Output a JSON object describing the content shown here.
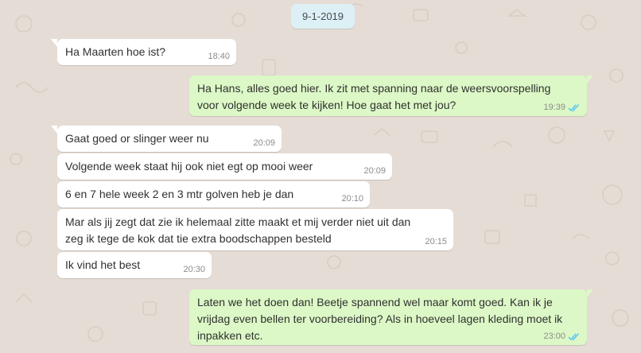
{
  "conversation": {
    "date": "9-1-2019",
    "messages": [
      {
        "direction": "in",
        "text": [
          "Ha Maarten hoe ist?"
        ],
        "time": "18:40"
      },
      {
        "direction": "out",
        "text": [
          "Ha Hans, alles goed hier. Ik zit met spanning naar de weersvoorspelling",
          "voor volgende week te kijken! Hoe gaat het met jou?"
        ],
        "time": "19:39",
        "status": "read"
      },
      {
        "direction": "in",
        "text": [
          "Gaat goed or slinger weer nu"
        ],
        "time": "20:09"
      },
      {
        "direction": "in",
        "text": [
          "Volgende week staat hij ook niet egt op mooi weer"
        ],
        "time": "20:09"
      },
      {
        "direction": "in",
        "text": [
          "6 en 7 hele week 2 en 3 mtr golven heb je dan"
        ],
        "time": "20:10"
      },
      {
        "direction": "in",
        "text": [
          "Mar als jij zegt dat zie ik helemaal zitte maakt et mij verder niet uit dan",
          "zeg ik tege de kok dat tie extra boodschappen besteld"
        ],
        "time": "20:15"
      },
      {
        "direction": "in",
        "text": [
          "Ik vind het best"
        ],
        "time": "20:30"
      },
      {
        "direction": "out",
        "text": [
          "Laten we het doen dan! Beetje spannend wel maar komt goed. Kan ik je",
          "vrijdag even bellen ter voorbereiding? Als in hoeveel lagen kleding moet ik",
          "inpakken etc."
        ],
        "time": "23:00",
        "status": "read"
      }
    ]
  },
  "colors": {
    "wallpaper": "#e5ddd5",
    "incoming_bubble": "#ffffff",
    "outgoing_bubble": "#dcf8c6",
    "date_pill": "#dcf0f6",
    "read_ticks": "#4fc3f7"
  },
  "icons": {
    "read_status": "double-check-icon"
  }
}
